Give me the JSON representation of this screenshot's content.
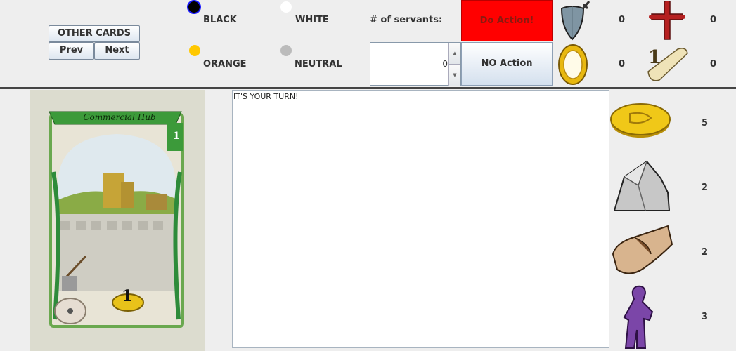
{
  "nav": {
    "other_cards_label": "OTHER CARDS",
    "prev_label": "Prev",
    "next_label": "Next"
  },
  "players": [
    {
      "label": "BLACK",
      "color": "#000000",
      "selected": true
    },
    {
      "label": "WHITE",
      "color": "#ffffff",
      "selected": false
    },
    {
      "label": "ORANGE",
      "color": "#ffc800",
      "selected": false
    },
    {
      "label": "NEUTRAL",
      "color": "#bbbbbb",
      "selected": false
    }
  ],
  "servants": {
    "label": "# of servants:",
    "value": "0"
  },
  "actions": {
    "do_action_label": "Do Action!",
    "no_action_label": "NO Action"
  },
  "scores": {
    "shield": "0",
    "cross": "0",
    "mirror": "0",
    "scroll": "0"
  },
  "card": {
    "title": "Commercial Hub",
    "corner_number": "1",
    "coin_value": "1"
  },
  "log": {
    "text": "IT'S YOUR TURN!"
  },
  "resources": {
    "gold": "5",
    "stone": "2",
    "wood": "2",
    "worker": "3"
  },
  "colors": {
    "do_action_bg": "#ff0000",
    "panel_bg": "#eeeeee",
    "divider": "#444444"
  }
}
